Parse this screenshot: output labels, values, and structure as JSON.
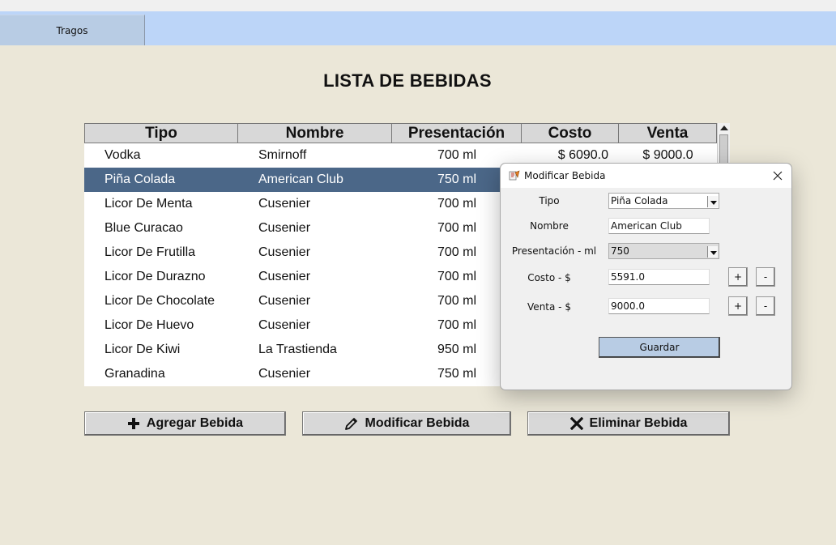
{
  "tabs": [
    {
      "label": "Tragos"
    }
  ],
  "page_title": "LISTA DE BEBIDAS",
  "table": {
    "headers": [
      "Tipo",
      "Nombre",
      "Presentación",
      "Costo",
      "Venta"
    ],
    "rows": [
      {
        "tipo": "Vodka",
        "nombre": "Smirnoff",
        "presentacion": "700 ml",
        "costo": "$ 6090.0",
        "venta": "$ 9000.0"
      },
      {
        "tipo": "Piña Colada",
        "nombre": "American Club",
        "presentacion": "750 ml",
        "costo": "",
        "venta": ""
      },
      {
        "tipo": "Licor De Menta",
        "nombre": "Cusenier",
        "presentacion": "700 ml",
        "costo": "",
        "venta": ""
      },
      {
        "tipo": "Blue Curacao",
        "nombre": "Cusenier",
        "presentacion": "700 ml",
        "costo": "",
        "venta": ""
      },
      {
        "tipo": "Licor De Frutilla",
        "nombre": "Cusenier",
        "presentacion": "700 ml",
        "costo": "",
        "venta": ""
      },
      {
        "tipo": "Licor De Durazno",
        "nombre": "Cusenier",
        "presentacion": "700 ml",
        "costo": "",
        "venta": ""
      },
      {
        "tipo": "Licor De Chocolate",
        "nombre": "Cusenier",
        "presentacion": "700 ml",
        "costo": "",
        "venta": ""
      },
      {
        "tipo": "Licor De Huevo",
        "nombre": "Cusenier",
        "presentacion": "700 ml",
        "costo": "",
        "venta": ""
      },
      {
        "tipo": "Licor De Kiwi",
        "nombre": "La Trastienda",
        "presentacion": "950 ml",
        "costo": "",
        "venta": ""
      },
      {
        "tipo": "Granadina",
        "nombre": "Cusenier",
        "presentacion": "750 ml",
        "costo": "",
        "venta": ""
      }
    ]
  },
  "actions": {
    "add_label": "Agregar Bebida",
    "edit_label": "Modificar Bebida",
    "delete_label": "Eliminar Bebida"
  },
  "dialog": {
    "title": "Modificar Bebida",
    "tipo_label": "Tipo",
    "tipo_value": "Piña Colada",
    "nombre_label": "Nombre",
    "nombre_value": "American Club",
    "presentacion_label": "Presentación - ml",
    "presentacion_value": "750",
    "costo_label": "Costo - $",
    "costo_value": "5591.0",
    "venta_label": "Venta - $",
    "venta_value": "9000.0",
    "plus": "+",
    "minus": "-",
    "save_label": "Guardar"
  },
  "colors": {
    "background": "#ebe7d8",
    "tabbar": "#bcd5f8",
    "selected_row": "#4b6788",
    "save_button": "#b8cce4"
  },
  "icons": [
    "plus-icon",
    "pencil-icon",
    "x-icon",
    "app-icon",
    "close-icon",
    "dropdown-arrow-icon"
  ]
}
